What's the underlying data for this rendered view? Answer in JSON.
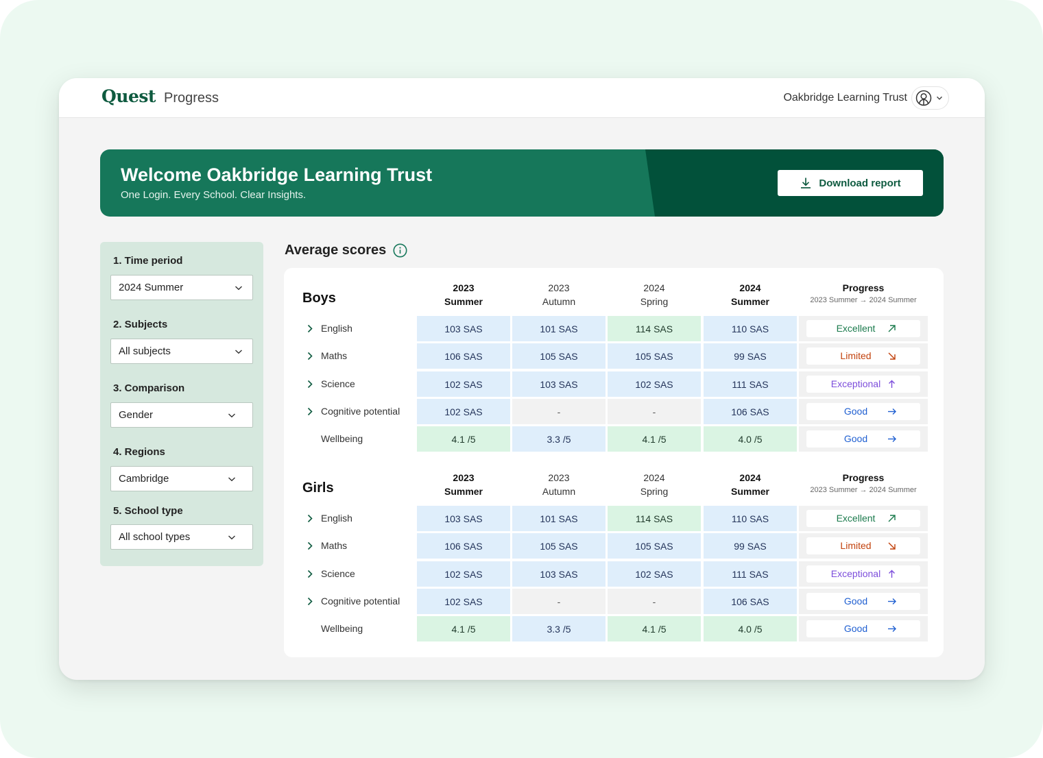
{
  "app": {
    "brand_name": "Quest",
    "product_name": "Progress",
    "org_name": "Oakbridge Learning Trust"
  },
  "hero": {
    "title": "Welcome Oakbridge Learning Trust",
    "subtitle": "One Login. Every School. Clear Insights.",
    "download_label": "Download report"
  },
  "filters": [
    {
      "label": "1. Time period",
      "value": "2024 Summer"
    },
    {
      "label": "2. Subjects",
      "value": "All subjects"
    },
    {
      "label": "3. Comparison",
      "value": "Gender"
    },
    {
      "label": "4. Regions",
      "value": "Cambridge"
    },
    {
      "label": "5. School type",
      "value": "All school types"
    }
  ],
  "scores": {
    "title": "Average scores",
    "columns": [
      {
        "year": "2023",
        "term": "Summer",
        "bold": true
      },
      {
        "year": "2023",
        "term": "Autumn",
        "bold": false
      },
      {
        "year": "2024",
        "term": "Spring",
        "bold": false
      },
      {
        "year": "2024",
        "term": "Summer",
        "bold": true
      }
    ],
    "progress_header": "Progress",
    "progress_subheader": "2023 Summer → 2024 Summer",
    "groups": [
      {
        "title": "Boys",
        "rows": [
          {
            "label": "English",
            "expandable": true,
            "cells": [
              {
                "v": "103 SAS",
                "tone": "blue"
              },
              {
                "v": "101 SAS",
                "tone": "blue"
              },
              {
                "v": "114 SAS",
                "tone": "green"
              },
              {
                "v": "110 SAS",
                "tone": "blue"
              }
            ],
            "progress": "Excellent",
            "progress_kind": "excellent"
          },
          {
            "label": "Maths",
            "expandable": true,
            "cells": [
              {
                "v": "106 SAS",
                "tone": "blue"
              },
              {
                "v": "105 SAS",
                "tone": "blue"
              },
              {
                "v": "105 SAS",
                "tone": "blue"
              },
              {
                "v": "99 SAS",
                "tone": "blue"
              }
            ],
            "progress": "Limited",
            "progress_kind": "limited"
          },
          {
            "label": "Science",
            "expandable": true,
            "cells": [
              {
                "v": "102 SAS",
                "tone": "blue"
              },
              {
                "v": "103 SAS",
                "tone": "blue"
              },
              {
                "v": "102 SAS",
                "tone": "blue"
              },
              {
                "v": "111 SAS",
                "tone": "blue"
              }
            ],
            "progress": "Exceptional",
            "progress_kind": "exceptional"
          },
          {
            "label": "Cognitive potential",
            "expandable": true,
            "cells": [
              {
                "v": "102 SAS",
                "tone": "blue"
              },
              {
                "v": "-",
                "tone": "grey"
              },
              {
                "v": "-",
                "tone": "grey"
              },
              {
                "v": "106 SAS",
                "tone": "blue"
              }
            ],
            "progress": "Good",
            "progress_kind": "good"
          },
          {
            "label": "Wellbeing",
            "expandable": false,
            "cells": [
              {
                "v": "4.1 /5",
                "tone": "green"
              },
              {
                "v": "3.3 /5",
                "tone": "blue"
              },
              {
                "v": "4.1 /5",
                "tone": "green"
              },
              {
                "v": "4.0 /5",
                "tone": "green"
              }
            ],
            "progress": "Good",
            "progress_kind": "good"
          }
        ]
      },
      {
        "title": "Girls",
        "rows": [
          {
            "label": "English",
            "expandable": true,
            "cells": [
              {
                "v": "103 SAS",
                "tone": "blue"
              },
              {
                "v": "101 SAS",
                "tone": "blue"
              },
              {
                "v": "114 SAS",
                "tone": "green"
              },
              {
                "v": "110 SAS",
                "tone": "blue"
              }
            ],
            "progress": "Excellent",
            "progress_kind": "excellent"
          },
          {
            "label": "Maths",
            "expandable": true,
            "cells": [
              {
                "v": "106 SAS",
                "tone": "blue"
              },
              {
                "v": "105 SAS",
                "tone": "blue"
              },
              {
                "v": "105 SAS",
                "tone": "blue"
              },
              {
                "v": "99 SAS",
                "tone": "blue"
              }
            ],
            "progress": "Limited",
            "progress_kind": "limited"
          },
          {
            "label": "Science",
            "expandable": true,
            "cells": [
              {
                "v": "102 SAS",
                "tone": "blue"
              },
              {
                "v": "103 SAS",
                "tone": "blue"
              },
              {
                "v": "102 SAS",
                "tone": "blue"
              },
              {
                "v": "111 SAS",
                "tone": "blue"
              }
            ],
            "progress": "Exceptional",
            "progress_kind": "exceptional"
          },
          {
            "label": "Cognitive potential",
            "expandable": true,
            "cells": [
              {
                "v": "102 SAS",
                "tone": "blue"
              },
              {
                "v": "-",
                "tone": "grey"
              },
              {
                "v": "-",
                "tone": "grey"
              },
              {
                "v": "106 SAS",
                "tone": "blue"
              }
            ],
            "progress": "Good",
            "progress_kind": "good"
          },
          {
            "label": "Wellbeing",
            "expandable": false,
            "cells": [
              {
                "v": "4.1 /5",
                "tone": "green"
              },
              {
                "v": "3.3 /5",
                "tone": "blue"
              },
              {
                "v": "4.1 /5",
                "tone": "green"
              },
              {
                "v": "4.0 /5",
                "tone": "green"
              }
            ],
            "progress": "Good",
            "progress_kind": "good"
          }
        ]
      }
    ]
  },
  "progress_styles": {
    "excellent": {
      "color": "#1a7a4c",
      "icon": "arrow-up-right-icon"
    },
    "limited": {
      "color": "#c2410c",
      "icon": "arrow-down-right-icon"
    },
    "exceptional": {
      "color": "#7c4ddb",
      "icon": "arrow-up-icon"
    },
    "good": {
      "color": "#1f5fd1",
      "icon": "arrow-right-icon"
    }
  },
  "colors": {
    "brand_green": "#0e5a3f",
    "hero_green": "#16775a",
    "hero_dark": "#02513a",
    "filter_panel": "#d6e8de",
    "cell_blue": "#dfeefb",
    "cell_green": "#daf4e3"
  }
}
